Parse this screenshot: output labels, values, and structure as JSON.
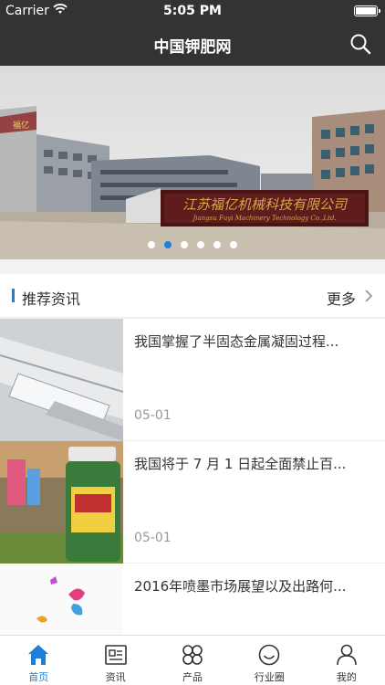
{
  "status_bar": {
    "carrier": "Carrier",
    "time": "5:05 PM"
  },
  "nav": {
    "title": "中国钾肥网",
    "search_icon": "search-icon"
  },
  "banner": {
    "sign_cn": "江苏福亿机械科技有限公司",
    "sign_en": "Jiangsu Fuyi Machinery Technology Co.,Ltd.",
    "sign_left": "福亿",
    "dot_count": 6,
    "active_dot": 1
  },
  "section": {
    "title": "推荐资讯",
    "more": "更多"
  },
  "news": [
    {
      "title": "我国掌握了半固态金属凝固过程...",
      "date": "05-01"
    },
    {
      "title": "我国将于 7 月 1 日起全面禁止百...",
      "date": "05-01"
    },
    {
      "title": "2016年喷墨市场展望以及出路何...",
      "date": ""
    }
  ],
  "tabs": [
    {
      "label": "首页",
      "icon": "home-icon",
      "active": true
    },
    {
      "label": "资讯",
      "icon": "news-icon",
      "active": false
    },
    {
      "label": "产品",
      "icon": "grid-icon",
      "active": false
    },
    {
      "label": "行业圈",
      "icon": "smile-icon",
      "active": false
    },
    {
      "label": "我的",
      "icon": "user-icon",
      "active": false
    }
  ],
  "colors": {
    "accent": "#1e7fd8",
    "nav_bg": "#333333"
  }
}
